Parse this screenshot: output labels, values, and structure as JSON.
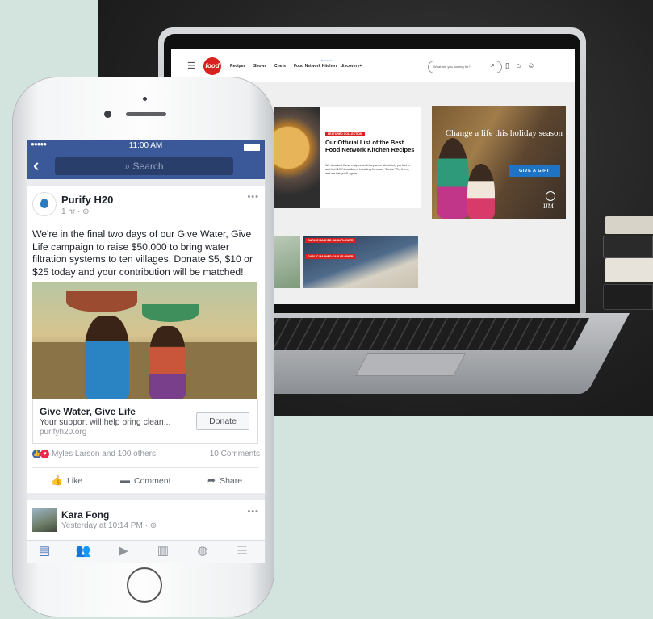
{
  "laptop": {
    "site": {
      "logo": "food",
      "nav_links": [
        "Recipes",
        "Shows",
        "Chefs",
        "Food Network Kitchen",
        "discovery+"
      ],
      "nav_badge": "Download",
      "search_placeholder": "What are you looking for?",
      "featured_badge": "FEATURED COLLECTION",
      "featured_title": "Our Official List of the Best Food Network Kitchen Recipes",
      "featured_desc": "We tweaked these recipes until they were absolutely perfect — and feel 100% confident in calling them our \"Bests.\" Try them, and we bet you'll agree.",
      "tile_tag_1": "GARLIC MASHED CAULIFLOWER",
      "tile_tag_2": "GARLIC MASHED CAULIFLOWER"
    },
    "ad": {
      "headline": "Change a life this holiday season",
      "button": "GIVE A GIFT",
      "logo": "IJM"
    }
  },
  "phone": {
    "status": {
      "signal": "●●●●●",
      "time": "11:00 AM"
    },
    "search_placeholder": "Search",
    "post": {
      "page_name": "Purify H20",
      "time": "1 hr · ",
      "text": "We're in the final two days of our Give Water, Give Life campaign to raise $50,000 to bring water filtration systems to ten villages. Donate $5, $10 or $25 today and your contribution will be matched!",
      "link_title": "Give Water, Give Life",
      "link_desc": "Your support will help bring clean...",
      "link_url": "purifyh20.org",
      "cta": "Donate",
      "reactions": "Myles Larson and 100 others",
      "comments": "10 Comments",
      "actions": [
        "Like",
        "Comment",
        "Share"
      ]
    },
    "post2": {
      "name": "Kara Fong",
      "time": "Yesterday at 10:14 PM · "
    },
    "tabs": [
      "news-feed",
      "friends",
      "watch",
      "marketplace",
      "notifications",
      "menu"
    ]
  },
  "colors": {
    "facebook_blue": "#3b5998",
    "food_red": "#d9211f",
    "ijm_button": "#1f73c5",
    "background": "#d3e3de"
  }
}
